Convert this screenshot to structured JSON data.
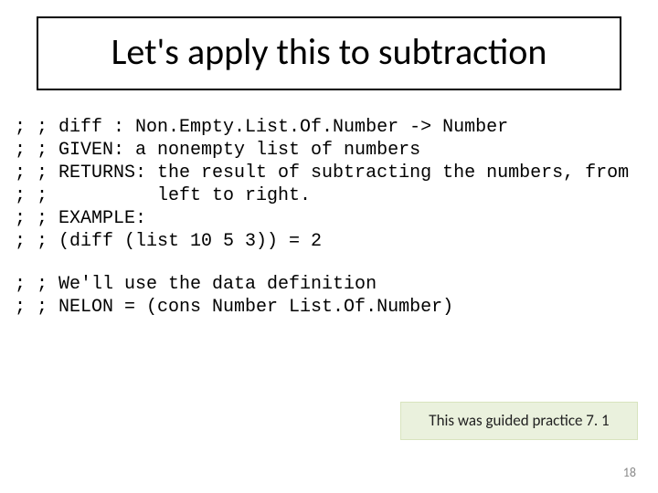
{
  "title": "Let's apply this to subtraction",
  "code_block_1": "; ; diff : Non.Empty.List.Of.Number -> Number\n; ; GIVEN: a nonempty list of numbers\n; ; RETURNS: the result of subtracting the numbers, from\n; ;          left to right.\n; ; EXAMPLE:\n; ; (diff (list 10 5 3)) = 2",
  "code_block_2": "; ; We'll use the data definition\n; ; NELON = (cons Number List.Of.Number)",
  "callout": "This was guided practice 7. 1",
  "page_number": "18"
}
